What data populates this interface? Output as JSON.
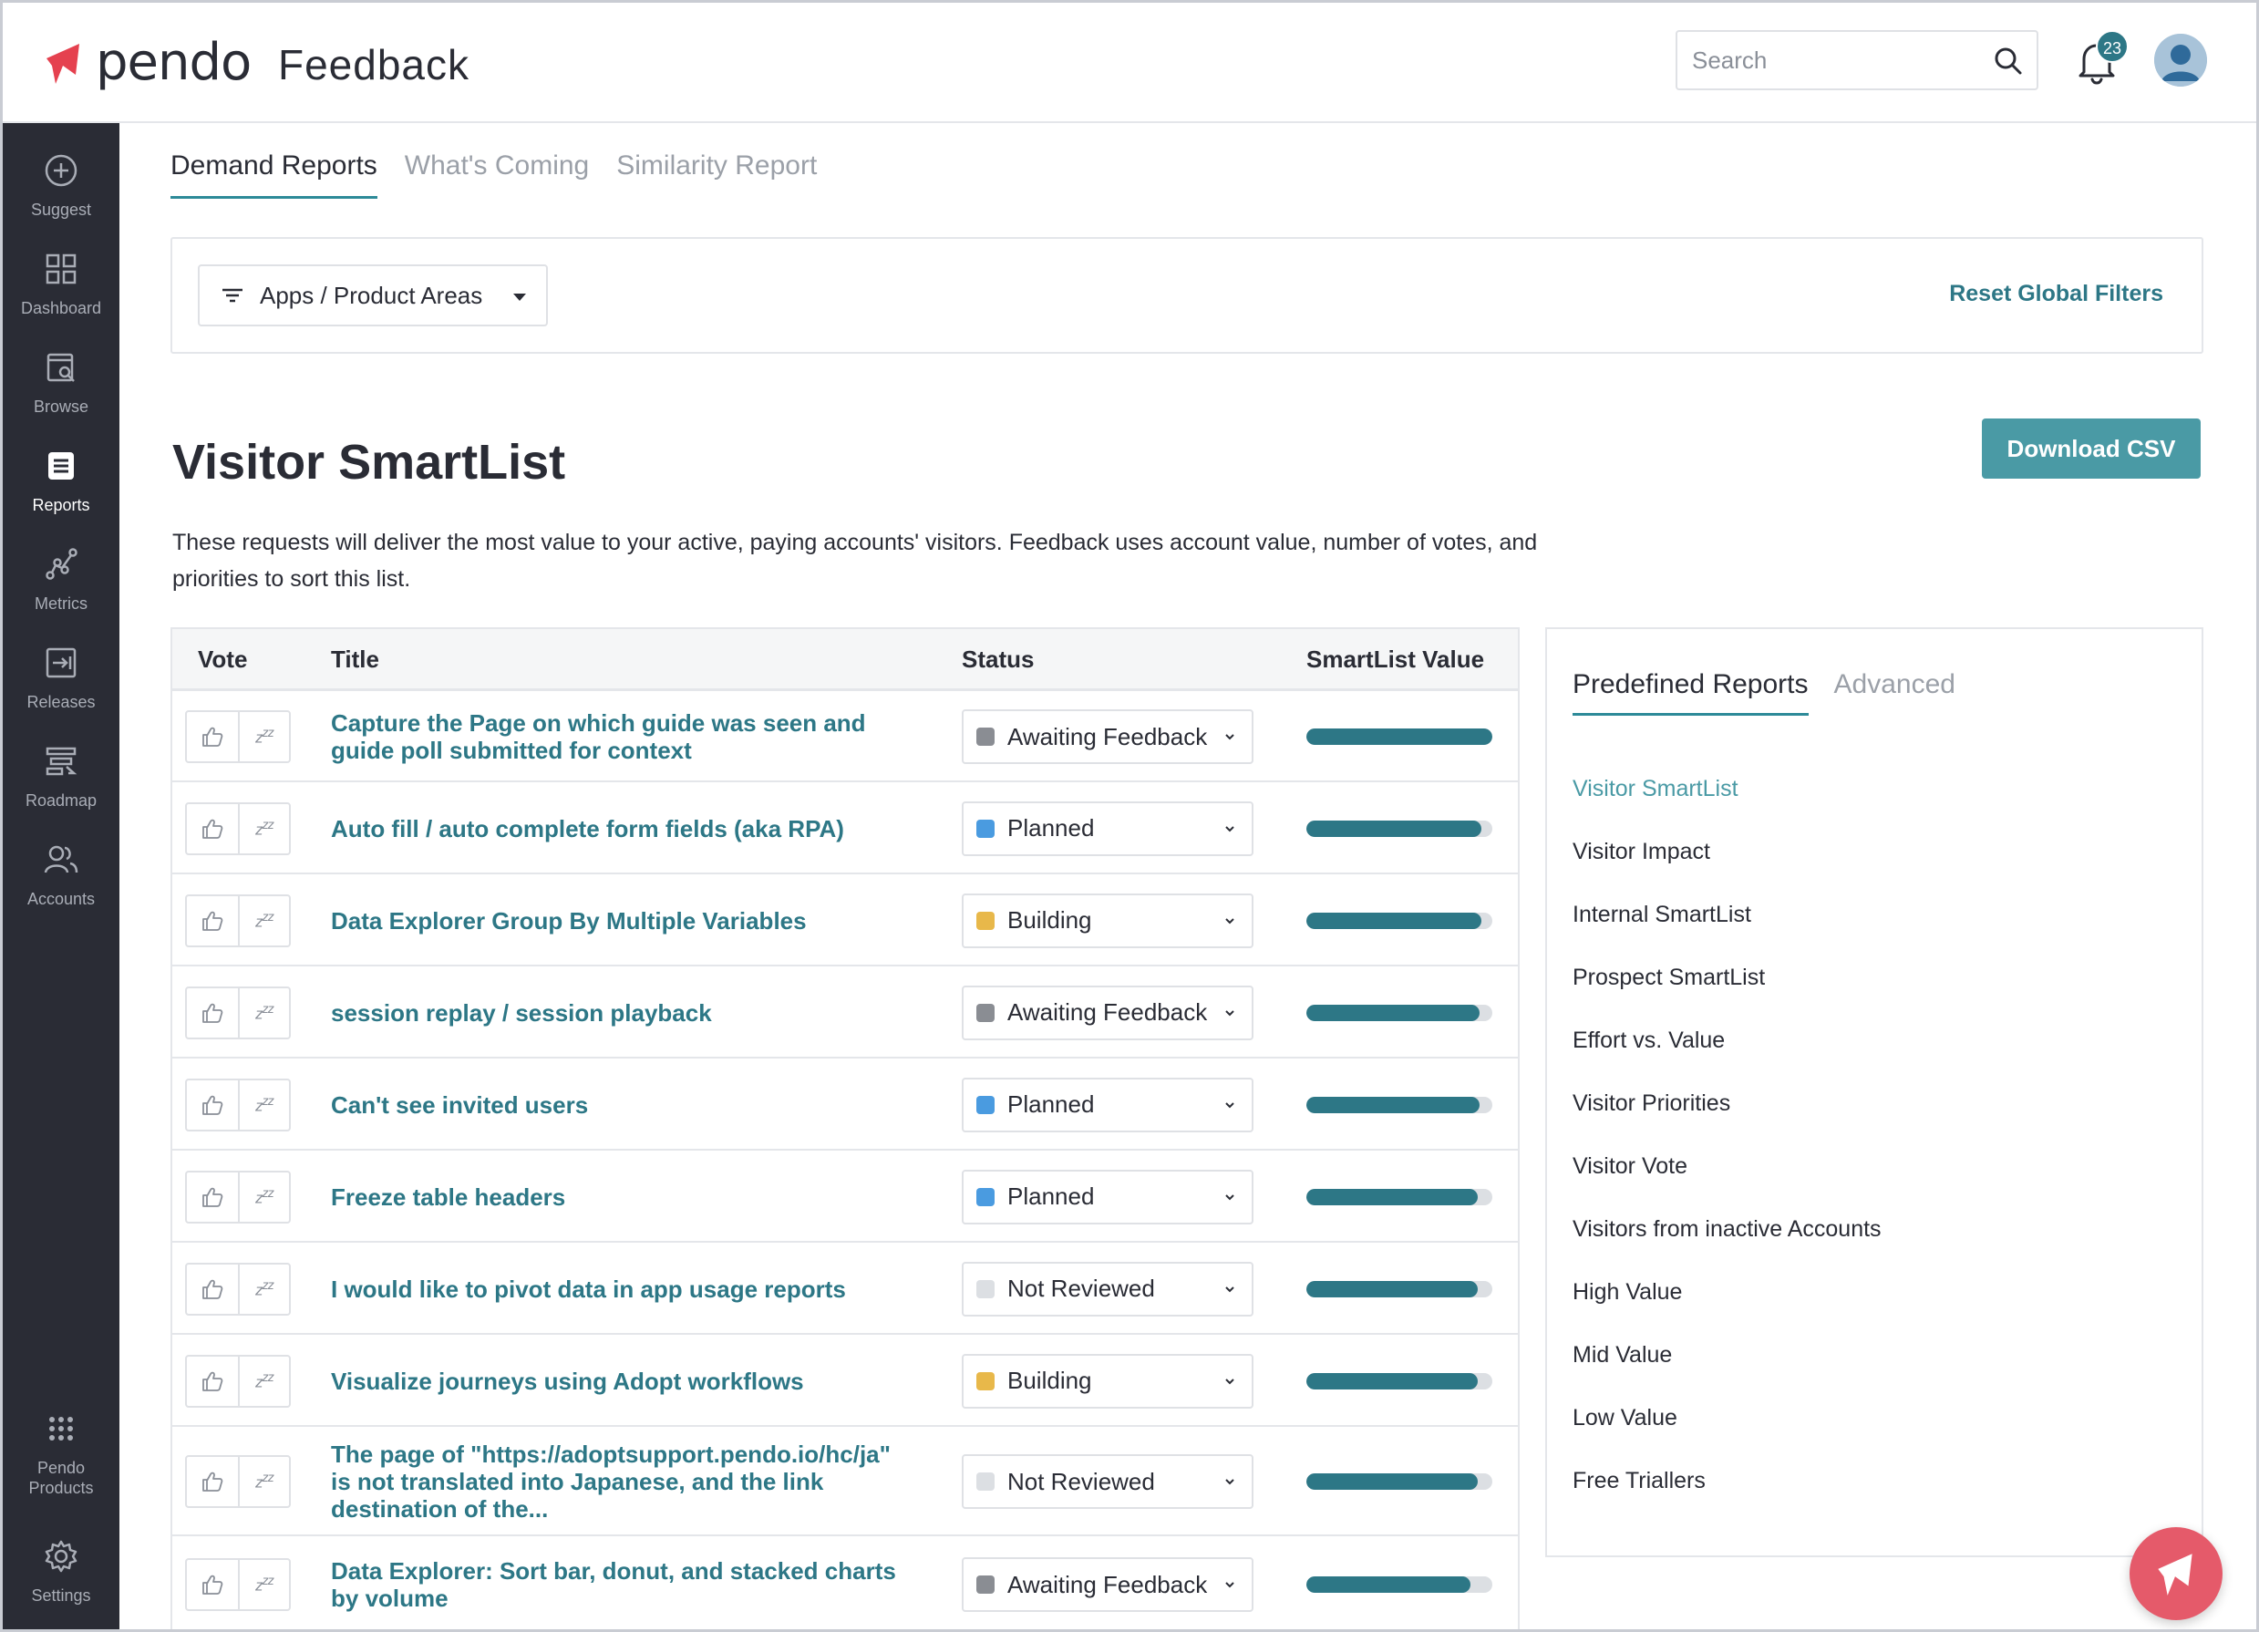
{
  "header": {
    "logo_text": "pendo",
    "product_name": "Feedback",
    "search_placeholder": "Search",
    "notification_count": "23"
  },
  "sidebar": {
    "items": [
      {
        "label": "Suggest",
        "icon": "plus-circle-icon"
      },
      {
        "label": "Dashboard",
        "icon": "grid-icon"
      },
      {
        "label": "Browse",
        "icon": "browse-icon"
      },
      {
        "label": "Reports",
        "icon": "list-icon"
      },
      {
        "label": "Metrics",
        "icon": "metrics-icon"
      },
      {
        "label": "Releases",
        "icon": "releases-icon"
      },
      {
        "label": "Roadmap",
        "icon": "roadmap-icon"
      },
      {
        "label": "Accounts",
        "icon": "users-icon"
      }
    ],
    "bottom": {
      "products_line1": "Pendo",
      "products_line2": "Products",
      "settings": "Settings"
    }
  },
  "tabs": [
    "Demand Reports",
    "What's Coming",
    "Similarity Report"
  ],
  "filters": {
    "apps_button": "Apps / Product Areas",
    "reset": "Reset Global Filters"
  },
  "page": {
    "title": "Visitor SmartList",
    "download": "Download CSV",
    "description": "These requests will deliver the most value to your active, paying accounts' visitors. Feedback uses account value, number of votes, and priorities to sort this list."
  },
  "table": {
    "headers": {
      "vote": "Vote",
      "title": "Title",
      "status": "Status",
      "value": "SmartList Value"
    },
    "rows": [
      {
        "title": "Capture the Page on which guide was seen and guide poll submitted for context",
        "status": "Awaiting Feedback",
        "status_color": "#8a8d93",
        "value": 1.0
      },
      {
        "title": "Auto fill / auto complete form fields (aka RPA)",
        "status": "Planned",
        "status_color": "#4a9be0",
        "value": 0.94
      },
      {
        "title": "Data Explorer Group By Multiple Variables",
        "status": "Building",
        "status_color": "#e8b84a",
        "value": 0.94
      },
      {
        "title": "session replay / session playback",
        "status": "Awaiting Feedback",
        "status_color": "#8a8d93",
        "value": 0.93
      },
      {
        "title": "Can't see invited users",
        "status": "Planned",
        "status_color": "#4a9be0",
        "value": 0.93
      },
      {
        "title": "Freeze table headers",
        "status": "Planned",
        "status_color": "#4a9be0",
        "value": 0.92
      },
      {
        "title": "I would like to pivot data in app usage reports",
        "status": "Not Reviewed",
        "status_color": "#dcdfe3",
        "value": 0.92
      },
      {
        "title": "Visualize journeys using Adopt workflows",
        "status": "Building",
        "status_color": "#e8b84a",
        "value": 0.92
      },
      {
        "title": "The page of \"https://adoptsupport.pendo.io/hc/ja\" is not translated into Japanese, and the link destination of the...",
        "status": "Not Reviewed",
        "status_color": "#dcdfe3",
        "value": 0.92
      },
      {
        "title": "Data Explorer: Sort bar, donut, and stacked charts by volume",
        "status": "Awaiting Feedback",
        "status_color": "#8a8d93",
        "value": 0.88
      }
    ]
  },
  "panel": {
    "tabs": [
      "Predefined Reports",
      "Advanced"
    ],
    "items": [
      "Visitor SmartList",
      "Visitor Impact",
      "Internal SmartList",
      "Prospect SmartList",
      "Effort vs. Value",
      "Visitor Priorities",
      "Visitor Vote",
      "Visitors from inactive Accounts",
      "High Value",
      "Mid Value",
      "Low Value",
      "Free Triallers"
    ]
  },
  "colors": {
    "accent": "#2d7786",
    "sidebar_bg": "#2a2c35",
    "button": "#4a9aa5",
    "fab": "#e55a6a"
  }
}
